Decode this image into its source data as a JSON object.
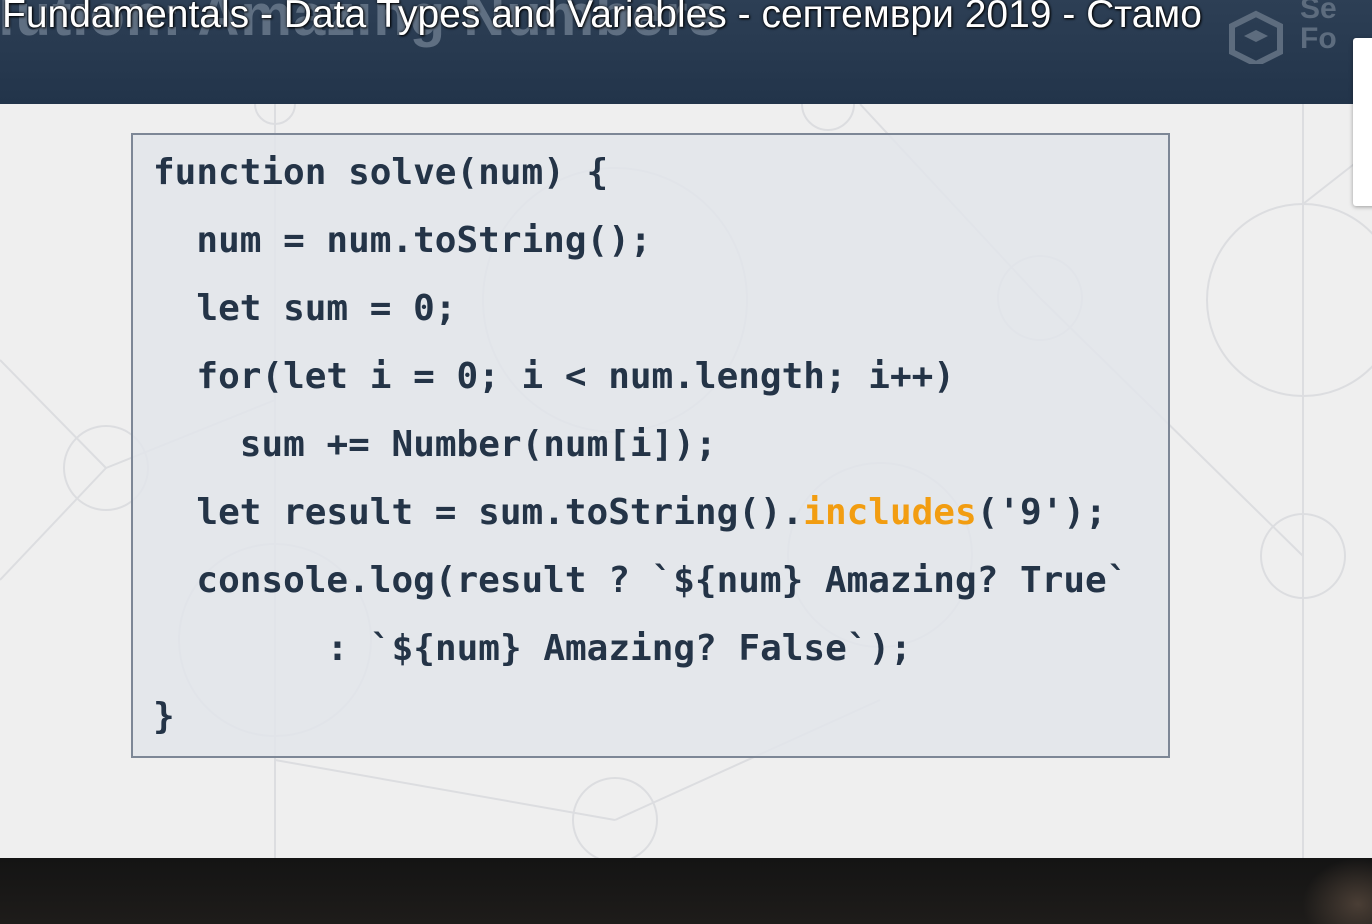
{
  "video": {
    "title": "Fundamentals - Data Types and Variables - септември 2019 - Стамо"
  },
  "slide": {
    "heading": "olution: Amazing Numbers",
    "logo_text": "Se\nFo"
  },
  "code": {
    "lines": [
      {
        "indent": 0,
        "before": "function solve(num) {",
        "highlight": "",
        "after": ""
      },
      {
        "indent": 1,
        "before": "num = num.toString();",
        "highlight": "",
        "after": ""
      },
      {
        "indent": 1,
        "before": "let sum = 0;",
        "highlight": "",
        "after": ""
      },
      {
        "indent": 1,
        "before": "for(let i = 0; i < num.length; i++)",
        "highlight": "",
        "after": ""
      },
      {
        "indent": 2,
        "before": "sum += Number(num[i]);",
        "highlight": "",
        "after": ""
      },
      {
        "indent": 1,
        "before": "let result = sum.toString().",
        "highlight": "includes",
        "after": "('9');"
      },
      {
        "indent": 1,
        "before": "console.log(result ? `${num} Amazing? True`",
        "highlight": "",
        "after": ""
      },
      {
        "indent": 4,
        "before": ": `${num} Amazing? False`);",
        "highlight": "",
        "after": ""
      },
      {
        "indent": 0,
        "before": "}",
        "highlight": "",
        "after": ""
      }
    ],
    "highlight_color": "#f29d11",
    "text_color": "#243447"
  },
  "colors": {
    "header": "#2d3f55",
    "slide_background": "#efefef",
    "code_border": "#7d8796"
  }
}
